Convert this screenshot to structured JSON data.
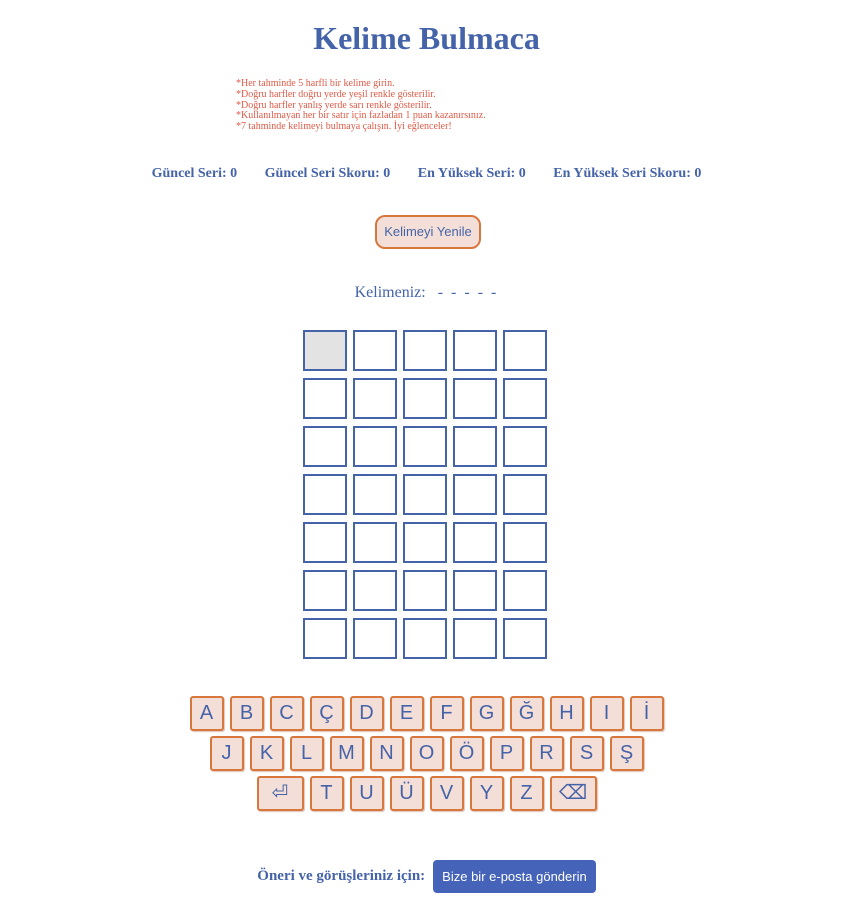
{
  "title": "Kelime Bulmaca",
  "rules": [
    "*Her tahminde 5 harfli bir kelime girin.",
    "*Doğru harfler doğru yerde yeşil renkle gösterilir.",
    "*Doğru harfler yanlış yerde sarı renkle gösterilir.",
    "*Kullanılmayan her bir satır için fazladan 1 puan kazanırsınız.",
    "*7 tahminde kelimeyi bulmaya çalışın. İyi eğlenceler!"
  ],
  "stats": {
    "current_streak": "Güncel Seri: 0",
    "current_streak_score": "Güncel Seri Skoru: 0",
    "best_streak": "En Yüksek Seri: 0",
    "best_streak_score": "En Yüksek Seri Skoru: 0"
  },
  "refresh_label": "Kelimeyi Yenile",
  "word_label": "Kelimeniz:",
  "word_mask": "- - - - -",
  "grid": {
    "rows": 7,
    "cols": 5,
    "active_cell": [
      0,
      0
    ]
  },
  "keyboard": {
    "row1": [
      "A",
      "B",
      "C",
      "Ç",
      "D",
      "E",
      "F",
      "G",
      "Ğ",
      "H",
      "I",
      "İ"
    ],
    "row2": [
      "J",
      "K",
      "L",
      "M",
      "N",
      "O",
      "Ö",
      "P",
      "R",
      "S",
      "Ş"
    ],
    "row3": [
      "⏎",
      "T",
      "U",
      "Ü",
      "V",
      "Y",
      "Z",
      "⌫"
    ]
  },
  "footer": {
    "label": "Öneri ve görüşleriniz için:",
    "button": "Bize bir e-posta gönderin"
  },
  "colors": {
    "primary": "#4563a8",
    "rules_text": "#e05a47",
    "key_bg": "#f4dfd8",
    "key_border": "#d8773d",
    "active_cell": "#e3e3e3",
    "mail_button": "#4563b8"
  }
}
